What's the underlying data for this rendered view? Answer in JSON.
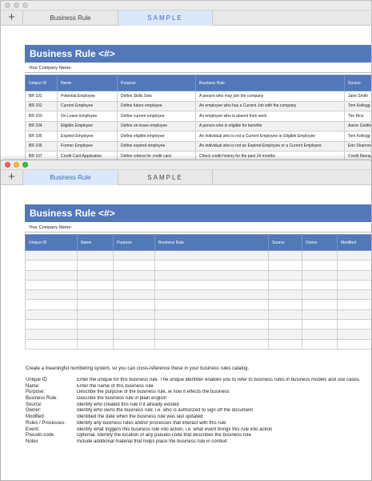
{
  "tabs": {
    "plus": "+",
    "business_rule": "Business Rule",
    "sample": "SAMPLE"
  },
  "document": {
    "title": "Business Rule <#>",
    "company_label": "Your Company Name:"
  },
  "sample_table": {
    "columns": [
      "Unique ID",
      "Name",
      "Purpose",
      "Business Rule",
      "Source"
    ],
    "rows": [
      [
        "BR 101",
        "Potential Employee",
        "Define Skills Sets",
        "A person who may join the company",
        "Jane Smith"
      ],
      [
        "BR 102",
        "Current Employee",
        "Define future employee",
        "An employee who has a Current Job with the company",
        "Tom Kellogg"
      ],
      [
        "BR 103",
        "On Leave Employee",
        "Define current employee",
        "An employee who is absent from work",
        "Tim Rice"
      ],
      [
        "BR 104",
        "Eligible Employee",
        "Define on-leave employee",
        "A person who is eligible for benefits",
        "Aaron Goldberg"
      ],
      [
        "BR 105",
        "Expired Employee",
        "Define eligible employee",
        "An individual who is not a Current Employee or Eligible Employee",
        "Tom Kellogg"
      ],
      [
        "BR 106",
        "Former Employee",
        "Define expired employee",
        "An individual who is not an Expired Employee or a Current Employee",
        "Erin Shannon"
      ],
      [
        "BR 107",
        "Credit Card Application",
        "Define criteria for credit card",
        "Check credit history for the past 24 months",
        "Credit Manager"
      ]
    ]
  },
  "template_table": {
    "columns": [
      "Unique ID",
      "Name",
      "Purpose",
      "Business Rule",
      "Source",
      "Owner",
      "Modified"
    ]
  },
  "notes": {
    "intro": "Create a meaningful numbering system, so you can cross-reference these in your business rules catalog.",
    "items": [
      {
        "term": "Unique ID",
        "desc": "Enter the unique for this business rule. The unique identifier enables you to refer to business rules in business models and use cases."
      },
      {
        "term": "Name:",
        "desc": "Enter the name of this business rule"
      },
      {
        "term": "Purpose:",
        "desc": "Describe the purpose of the business rule, ie how it effects the business"
      },
      {
        "term": "Business Rule:",
        "desc": "Describe the business rule in plain english"
      },
      {
        "term": "Source:",
        "desc": "Identify who created this rule if it already existed"
      },
      {
        "term": "Owner:",
        "desc": "Identify who owns the business rule, i.e. who is authorized to sign off the document"
      },
      {
        "term": "Modified",
        "desc": "Identified the date when the business rule was last updated"
      },
      {
        "term": "Rules / Processes:",
        "desc": "Identify any business rules and/or processes that interact with this rule"
      },
      {
        "term": "Event:",
        "desc": "Identify what triggers this business rule into action, i.e. what event brings this rule into action"
      },
      {
        "term": "Pseudo-code",
        "desc": "Optional. Identify the location of any pseudo-code that describes the business rule"
      },
      {
        "term": "Notes",
        "desc": "Include additional material that helps place the business rule in context"
      }
    ]
  }
}
